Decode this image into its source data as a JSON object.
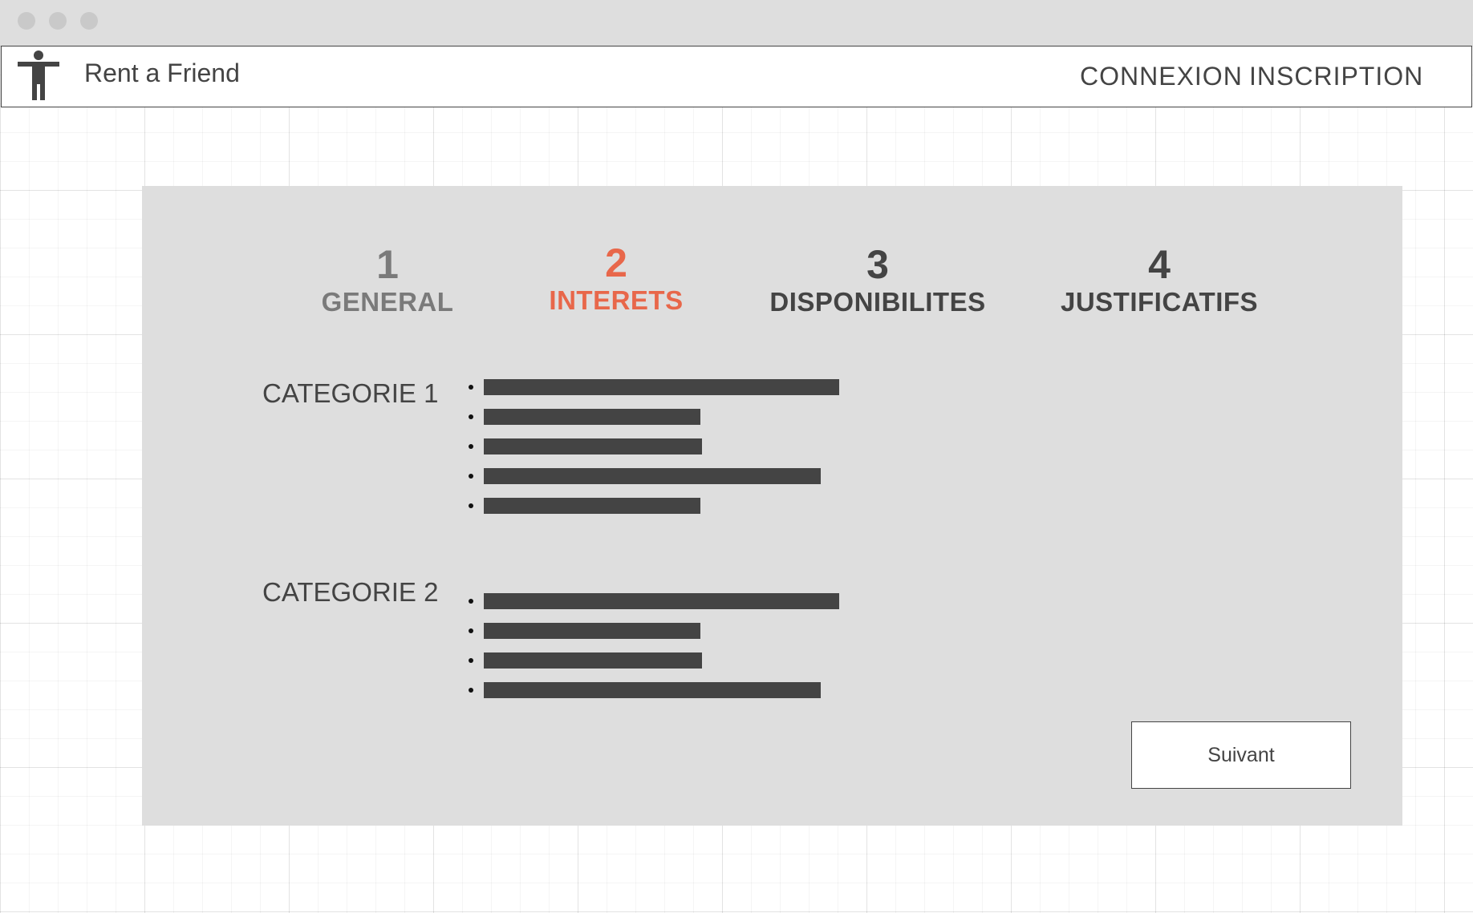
{
  "app": {
    "brand": "Rent a Friend"
  },
  "header": {
    "login_label": "CONNEXION",
    "signup_label": "INSCRIPTION"
  },
  "steps": [
    {
      "number": "1",
      "label": "GENERAL",
      "state": "done"
    },
    {
      "number": "2",
      "label": "INTERETS",
      "state": "active"
    },
    {
      "number": "3",
      "label": "DISPONIBILITES",
      "state": "todo"
    },
    {
      "number": "4",
      "label": "JUSTIFICATIFS",
      "state": "todo"
    }
  ],
  "categories": [
    {
      "title": "CATEGORIE 1",
      "item_count": 5
    },
    {
      "title": "CATEGORIE 2",
      "item_count": 4
    }
  ],
  "actions": {
    "next_label": "Suivant"
  },
  "colors": {
    "accent": "#e8674a",
    "text": "#444444",
    "panel": "#dedede",
    "chrome": "#dedede"
  },
  "icons": {
    "logo": "person-icon"
  }
}
